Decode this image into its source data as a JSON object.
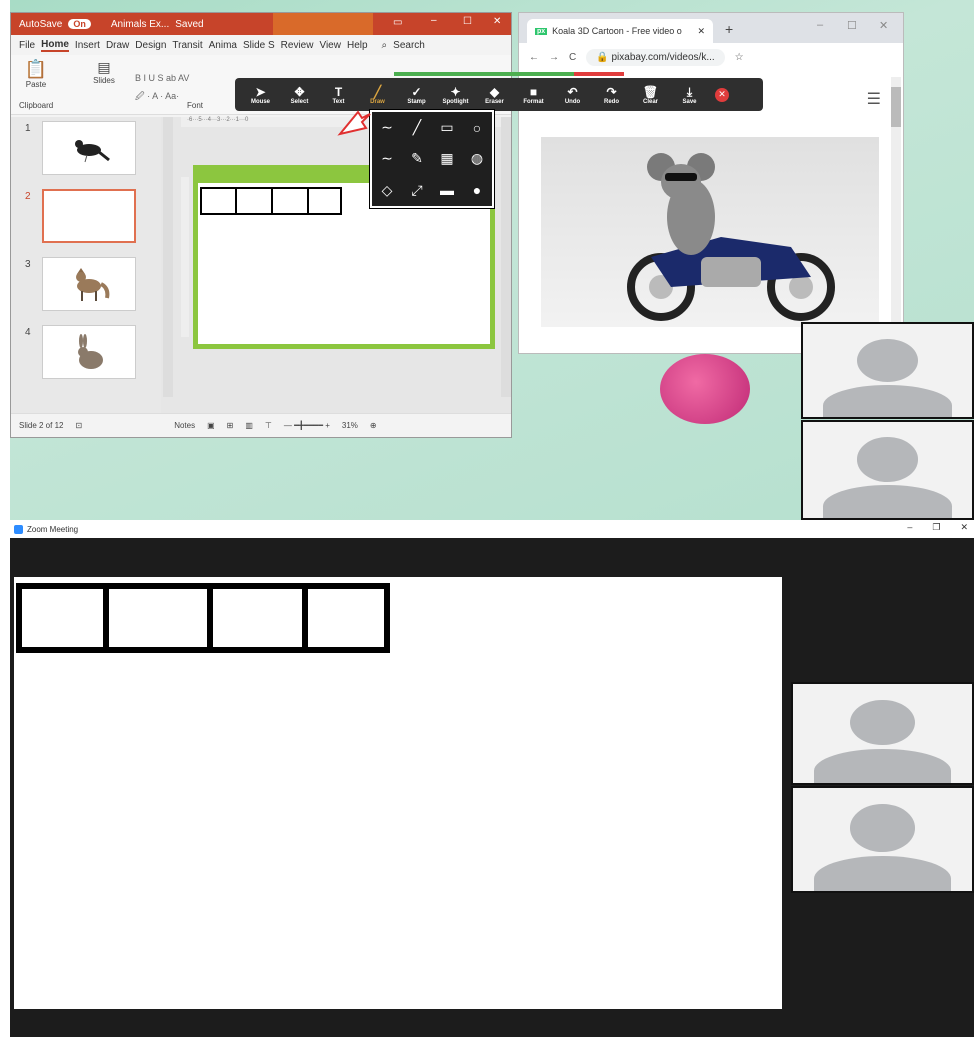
{
  "powerpoint": {
    "autosave_label": "AutoSave",
    "autosave_toggle": "On",
    "file_name": "Animals Ex...",
    "saved_status": "Saved",
    "menu": [
      "File",
      "Home",
      "Insert",
      "Draw",
      "Design",
      "Transit",
      "Anima",
      "Slide S",
      "Review",
      "View",
      "Help"
    ],
    "search_label": "Search",
    "ribbon": {
      "paste": "Paste",
      "slides": "Slides",
      "clipboard": "Clipboard",
      "font": "Font"
    },
    "thumbnails": [
      {
        "num": "1",
        "animal": "bird"
      },
      {
        "num": "2",
        "animal": ""
      },
      {
        "num": "3",
        "animal": "fox"
      },
      {
        "num": "4",
        "animal": "rabbit"
      }
    ],
    "status": {
      "slide_info": "Slide 2 of 12",
      "notes": "Notes",
      "zoom": "31%"
    }
  },
  "annotation_toolbar": {
    "tools": [
      {
        "label": "Mouse",
        "icon": "cursor-icon"
      },
      {
        "label": "Select",
        "icon": "move-icon"
      },
      {
        "label": "Text",
        "icon": "text-icon"
      },
      {
        "label": "Draw",
        "icon": "pen-icon",
        "active": true
      },
      {
        "label": "Stamp",
        "icon": "check-icon"
      },
      {
        "label": "Spotlight",
        "icon": "spotlight-icon"
      },
      {
        "label": "Eraser",
        "icon": "eraser-icon"
      },
      {
        "label": "Format",
        "icon": "format-icon"
      },
      {
        "label": "Undo",
        "icon": "undo-icon"
      },
      {
        "label": "Redo",
        "icon": "redo-icon"
      },
      {
        "label": "Clear",
        "icon": "trash-icon"
      },
      {
        "label": "Save",
        "icon": "save-icon"
      }
    ],
    "draw_options": [
      "freehand-line",
      "straight-line",
      "hollow-rectangle",
      "hollow-ellipse",
      "freehand-bold",
      "highlighter",
      "hollow-grid",
      "hollow-globe",
      "hollow-diamond",
      "double-arrow",
      "filled-rectangle",
      "filled-ellipse"
    ]
  },
  "browser": {
    "tab_title": "Koala 3D Cartoon - Free video o",
    "favicon": "px",
    "url": "pixabay.com/videos/k..."
  },
  "zoom": {
    "title": "Zoom Meeting"
  },
  "colors": {
    "ppt_brand": "#c7442a",
    "slide_border": "#8cc63f",
    "toolbar_bg": "#2f2f2f",
    "zoom_bg": "#1c1c1c",
    "draw_active": "#d9a441"
  }
}
